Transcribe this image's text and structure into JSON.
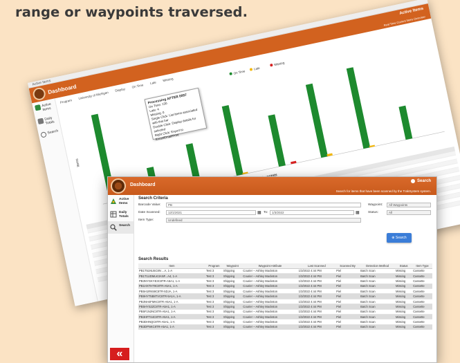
{
  "headline": "range or waypoints traversed.",
  "back_window": {
    "titlebar": "Active Items",
    "header_title": "Dashboard",
    "header_badge": "Active Items",
    "header_subtitle": "Real Time Current Items Overview",
    "nav": [
      {
        "label": "Active Items",
        "icon": "active-items-icon"
      },
      {
        "label": "Daily Totals",
        "icon": "daily-totals-icon"
      },
      {
        "label": "Search",
        "icon": "search-icon"
      }
    ],
    "toolbar": [
      "Program",
      "University of Michigan",
      "Display",
      "On Time",
      "Late",
      "Missing"
    ],
    "legend": [
      "On Time",
      "Late",
      "Missing"
    ],
    "y_label": "Items",
    "x_label": "Waypoints",
    "tooltip": {
      "title": "Processing AFTER 0097",
      "on_time": "On Time: 130",
      "late": "Late: 4",
      "missing": "Missing: 0",
      "lines": [
        "Single Click: List items associated with this bar",
        "Double Click: Display details for selected",
        "Right Click: Export to Excel/Email/Print"
      ]
    },
    "grid_headers": [
      "Item",
      "Scanned By",
      "Detection Method",
      "Status",
      "Item Type"
    ],
    "colors": {
      "on_time": "#1d8a2e",
      "late": "#f2b70c",
      "missing": "#d62222",
      "header": "#d2621f"
    }
  },
  "front_window": {
    "header_title": "Dashboard",
    "header_search": "Search",
    "header_subtitle": "Search for items that have been scanned by the TrakSystem system.",
    "nav": [
      {
        "label": "Active Items",
        "icon": "active-items-icon"
      },
      {
        "label": "Daily Totals",
        "icon": "daily-totals-icon"
      },
      {
        "label": "Search",
        "icon": "magnifier-icon"
      }
    ],
    "back_label": "«",
    "criteria": {
      "title": "Search Criteria",
      "barcode_label": "Barcode Value:",
      "barcode_value": "PB",
      "date_label": "Date Scanned:",
      "date_from": "12/1/2021",
      "date_to_label": "To:",
      "date_to": "1/3/2022",
      "item_type_label": "Item Type:",
      "item_type_value": "Undefined",
      "waypoint_label": "Waypoint:",
      "waypoint_value": "All Waypoints",
      "status_label": "Status:",
      "status_value": "All",
      "search_button": "Search"
    },
    "results": {
      "title": "Search Results",
      "columns": [
        "Item",
        "Program",
        "Waypoint",
        "Waypoint Attribute",
        "Last Scanned",
        "Scanned By",
        "Detection Method",
        "Status",
        "Item Type"
      ],
      "rows": [
        [
          "PB1T51NU5C8N ...A, 1-A",
          "Test 3",
          "Shipping",
          "Courier – Ashley Mackston",
          "1/3/2022 4:44 PM",
          "Piel",
          "Batch Scan",
          "Missing",
          "Cassette"
        ],
        [
          "PB1T1UDMLK3ANF...A4, 1-A",
          "Test 3",
          "Shipping",
          "Courier – Ashley Mackston",
          "1/3/2022 4:44 PM",
          "Piel",
          "Batch Scan",
          "Missing",
          "Cassette"
        ],
        [
          "PB3NYGKYE3C8TR-A5A1, 1-A",
          "Test 3",
          "Shipping",
          "Courier – Ashley Mackston",
          "1/3/2022 4:44 PM",
          "Piel",
          "Batch Scan",
          "Missing",
          "Cassette"
        ],
        [
          "PB1HXTHT9C8TR-A5A1, 1-A",
          "Test 3",
          "Shipping",
          "Courier – Ashley Mackston",
          "1/3/2022 4:44 PM",
          "Piel",
          "Batch Scan",
          "Missing",
          "Cassette"
        ],
        [
          "PB5H1RN59C8TR-5DJA, 1-A",
          "Test 3",
          "Shipping",
          "Courier – Ashley Mackston",
          "1/3/2022 4:44 PM",
          "Piel",
          "Batch Scan",
          "Missing",
          "Cassette"
        ],
        [
          "PB9HYT5B8TVC8TR-5A1A, 1-A",
          "Test 3",
          "Shipping",
          "Courier – Ashley Mackston",
          "1/3/2022 4:44 PM",
          "Piel",
          "Batch Scan",
          "Missing",
          "Cassette"
        ],
        [
          "PB3NH4FMKC8TR-A5A1, 1-A",
          "Test 3",
          "Shipping",
          "Courier – Ashley Mackston",
          "1/3/2022 4:44 PM",
          "Piel",
          "Batch Scan",
          "Missing",
          "Cassette"
        ],
        [
          "PB5HYS2ZC8TR-A5A1, 1-A",
          "Test 3",
          "Shipping",
          "Courier – Ashley Mackston",
          "1/3/2022 4:44 PM",
          "Piel",
          "Batch Scan",
          "Missing",
          "Cassette"
        ],
        [
          "PB5F1N2NC8TR-A5A1, 1-A",
          "Test 3",
          "Shipping",
          "Courier – Ashley Mackston",
          "1/3/2022 4:44 PM",
          "Piel",
          "Batch Scan",
          "Missing",
          "Cassette"
        ],
        [
          "PB3HFTS4C8TR-A5A1, 1-A",
          "Test 3",
          "Shipping",
          "Courier – Ashley Mackston",
          "1/3/2022 4:44 PM",
          "Piel",
          "Batch Scan",
          "Missing",
          "Cassette"
        ],
        [
          "PB3DHNQC8TR-A5A1, 1-A",
          "Test 3",
          "Shipping",
          "Courier – Ashley Mackston",
          "1/3/2022 4:44 PM",
          "Piel",
          "Batch Scan",
          "Missing",
          "Cassette"
        ],
        [
          "PB3DPNKC8TR-A5A1, 1-A",
          "Test 3",
          "Shipping",
          "Courier – Ashley Mackston",
          "1/3/2022 4:44 PM",
          "Piel",
          "Batch Scan",
          "Missing",
          "Cassette"
        ]
      ]
    }
  },
  "chart_data": {
    "type": "bar",
    "categories": [
      "1",
      "2",
      "3",
      "4",
      "5",
      "6",
      "7",
      "8"
    ],
    "series": [
      {
        "name": "On Time",
        "values": [
          120,
          35,
          55,
          95,
          70,
          100,
          110,
          45
        ]
      },
      {
        "name": "Late",
        "values": [
          0,
          6,
          4,
          2,
          0,
          3,
          2,
          0
        ]
      },
      {
        "name": "Missing",
        "values": [
          0,
          3,
          0,
          0,
          3,
          0,
          0,
          0
        ]
      }
    ],
    "ylim": [
      0,
      130
    ]
  }
}
